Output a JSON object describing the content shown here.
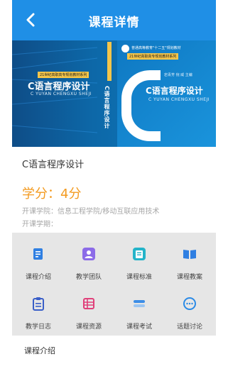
{
  "header": {
    "title": "课程详情",
    "back_icon": "chevron-left-icon"
  },
  "banner": {
    "left_tag": "21世纪高职高专规划教材系列",
    "left_title": "C语言程序设计",
    "left_subtitle": "C YUYAN CHENGXU SHEJI",
    "spine_title": "C语言程序设计",
    "cover_publisher": "普通高等教育\"十二五\"规划教材",
    "cover_series": "21世纪高职高专规划教材系列",
    "cover_authors": "岩青芳  倪 威  主编",
    "cover_title": "C语言程序设计",
    "cover_subtitle": "C YUYAN CHENGXU SHEJI",
    "colors": {
      "bg": "#0d68a8",
      "accent": "#f4c54a"
    }
  },
  "course": {
    "name": "C语言程序设计",
    "credits": "学分：4分",
    "college": "开课学院：信息工程学院/移动互联应用技术",
    "term": "开课学期："
  },
  "grid": {
    "items": [
      {
        "label": "课程介绍",
        "icon": "document-icon",
        "color": "#2f7fe2"
      },
      {
        "label": "教学团队",
        "icon": "user-icon",
        "color": "#8c6be8"
      },
      {
        "label": "课程标准",
        "icon": "book-standard-icon",
        "color": "#24b4c9"
      },
      {
        "label": "课程教案",
        "icon": "open-book-icon",
        "color": "#2f7fe2"
      },
      {
        "label": "教学日志",
        "icon": "clipboard-icon",
        "color": "#3a5fc8"
      },
      {
        "label": "课程资源",
        "icon": "resource-icon",
        "color": "#e0407a"
      },
      {
        "label": "课程考试",
        "icon": "exam-icon",
        "color": "#3c8de6"
      },
      {
        "label": "话题讨论",
        "icon": "chat-icon",
        "color": "#2a8ae6"
      }
    ]
  },
  "section": {
    "title": "课程介绍"
  }
}
